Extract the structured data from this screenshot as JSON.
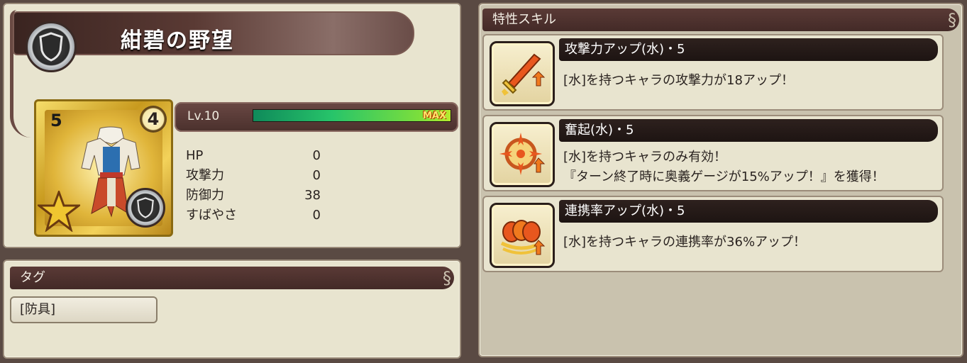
{
  "item": {
    "title": "紺碧の野望",
    "level_badge": "4",
    "star_rarity": "5",
    "type_icon": "shield-icon"
  },
  "level": {
    "label": "Lv.10",
    "max_label": "MAX",
    "progress_fraction": 1.0
  },
  "stats": [
    {
      "label": "HP",
      "value": "0"
    },
    {
      "label": "攻撃力",
      "value": "0"
    },
    {
      "label": "防御力",
      "value": "38"
    },
    {
      "label": "すばやさ",
      "value": "0"
    }
  ],
  "tags": {
    "header": "タグ",
    "items": [
      "[防具]"
    ]
  },
  "skills": {
    "header": "特性スキル",
    "items": [
      {
        "name": "攻撃力アップ(水)・5",
        "icon": "sword-up-icon",
        "lines": [
          "[水]を持つキャラの攻撃力が18アップ！"
        ]
      },
      {
        "name": "奮起(水)・5",
        "icon": "burst-up-icon",
        "lines": [
          "[水]を持つキャラのみ有効！",
          "『ターン終了時に奥義ゲージが15%アップ！』を獲得！"
        ]
      },
      {
        "name": "連携率アップ(水)・5",
        "icon": "chain-up-icon",
        "lines": [
          "[水]を持つキャラの連携率が36%アップ！"
        ]
      }
    ]
  },
  "colors": {
    "panel_bg": "#e8e4cf",
    "header_bg": "#432a27",
    "gauge_fill": "#27c46a",
    "max_text": "#ffe76a"
  }
}
